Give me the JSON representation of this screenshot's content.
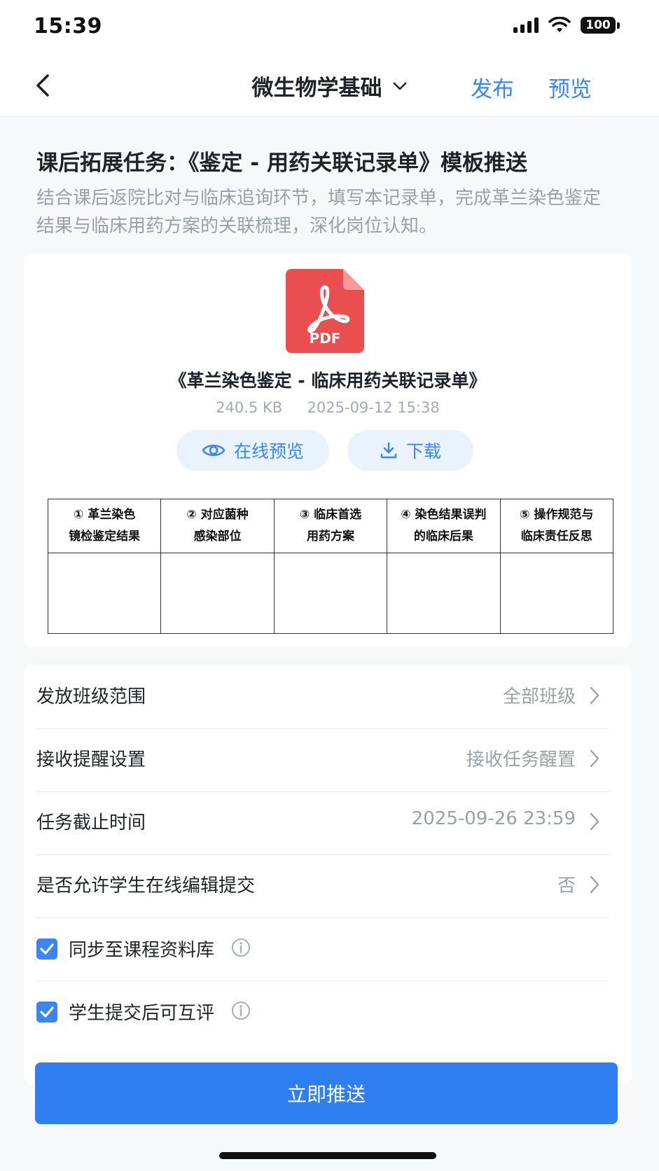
{
  "status_bar": {
    "time": "15:39",
    "battery": "100"
  },
  "nav": {
    "title": "微生物学基础",
    "publish": "发布",
    "preview": "预览"
  },
  "task": {
    "title": "课后拓展任务：《鉴定 - 用药关联记录单》模板推送",
    "description": "结合课后返院比对与临床追询环节，填写本记录单，完成革兰染色鉴定结果与临床用药方案的关联梳理，深化岗位认知。"
  },
  "file": {
    "icon_label": "PDF",
    "name": "《革兰染色鉴定 - 临床用药关联记录单》",
    "size": "240.5 KB",
    "date": "2025-09-12 15:38",
    "preview_label": "在线预览",
    "download_label": "下载",
    "table_headers": [
      {
        "l1": "① 革兰染色",
        "l2": "镜检鉴定结果"
      },
      {
        "l1": "② 对应菌种",
        "l2": "感染部位"
      },
      {
        "l1": "③ 临床首选",
        "l2": "用药方案"
      },
      {
        "l1": "④ 染色结果误判",
        "l2": "的临床后果"
      },
      {
        "l1": "⑤ 操作规范与",
        "l2": "临床责任反思"
      }
    ]
  },
  "settings": {
    "rows": [
      {
        "label": "发放班级范围",
        "value": "全部班级"
      },
      {
        "label": "接收提醒设置",
        "value": "接收任务醒置"
      },
      {
        "label": "任务截止时间",
        "value": "2025-09-26 23:59"
      },
      {
        "label": "是否允许学生在线编辑提交",
        "value": "否"
      }
    ],
    "checkboxes": [
      {
        "label": "同步至课程资料库",
        "checked": true
      },
      {
        "label": "学生提交后可互评",
        "checked": true
      }
    ]
  },
  "submit_label": "立即推送",
  "colors": {
    "accent": "#3a86f5",
    "pdf_red": "#ea4f4f"
  }
}
